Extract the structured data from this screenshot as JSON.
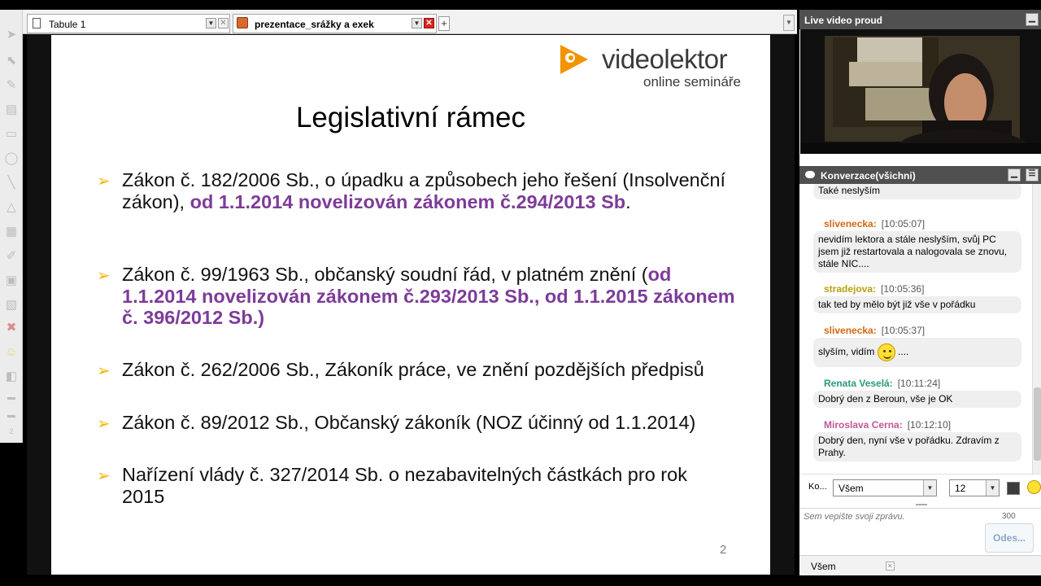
{
  "tabs": [
    {
      "label": "Tabule 1"
    },
    {
      "label": "prezentace_srážky a exek"
    }
  ],
  "slide": {
    "logo_brand_a": "video",
    "logo_brand_b": "lektor",
    "logo_sub": "online semináře",
    "title": "Legislativní rámec",
    "bullets": [
      {
        "plain": "Zákon č. 182/2006 Sb., o úpadku a způsobech jeho řešení (Insolvenční zákon), ",
        "highlight": "od 1.1.2014 novelizován zákonem č.294/2013 Sb",
        "tail": "."
      },
      {
        "plain": "Zákon č. 99/1963 Sb., občanský soudní řád, v platném znění (",
        "highlight": "od 1.1.2014 novelizován zákonem č.293/2013 Sb., od 1.1.2015 zákonem č. 396/2012 Sb.)",
        "tail": ""
      },
      {
        "plain": "Zákon č. 262/2006 Sb., Zákoník práce, ve znění pozdějších předpisů",
        "highlight": "",
        "tail": ""
      },
      {
        "plain": "Zákon č. 89/2012 Sb., Občanský zákoník (NOZ účinný od 1.1.2014)",
        "highlight": "",
        "tail": ""
      },
      {
        "plain": "Nařízení vlády č. 327/2014 Sb. o nezabavitelných částkách pro rok 2015",
        "highlight": "",
        "tail": ""
      }
    ],
    "page_number": "2"
  },
  "video_panel": {
    "title": "Live video proud"
  },
  "chat": {
    "title": "Konverzace(všichni)",
    "messages": [
      {
        "author": "",
        "time": "",
        "text": "Také neslyším"
      },
      {
        "author": "slivenecka:",
        "time": "[10:05:07]",
        "text": "nevidím lektora a stále neslyším, svůj PC jsem již restartovala a nalogovala se znovu, stále NIC...."
      },
      {
        "author": "stradejova:",
        "time": "[10:05:36]",
        "text": "tak ted by mělo být již vše v pořádku"
      },
      {
        "author": "slivenecka:",
        "time": "[10:05:37]",
        "text_before": "slyším, vidím",
        "text_after": "...."
      },
      {
        "author": "Renata Veselá:",
        "time": "[10:11:24]",
        "text": "Dobrý den z Beroun, vše je OK"
      },
      {
        "author": "Miroslava Cerna:",
        "time": "[10:12:10]",
        "text": "Dobrý den, nyní vše v pořádku. Zdravím z Prahy."
      }
    ],
    "author_colors": {
      "slivenecka": "#d4680f",
      "stradejova": "#b8a10a",
      "renata": "#2a9a7a",
      "miroslava": "#c2579a"
    },
    "ko_label": "Ko...",
    "recipient": "Všem",
    "font_size": "12",
    "compose_placeholder": "Sem vepište svoji zprávu.",
    "char_limit": "300",
    "send_label": "Odes...",
    "bottom_tab": "Všem"
  },
  "colors": {
    "highlight": "#7d3c98",
    "bullet_arrow": "#f2b705",
    "logo_orange": "#f29400"
  }
}
